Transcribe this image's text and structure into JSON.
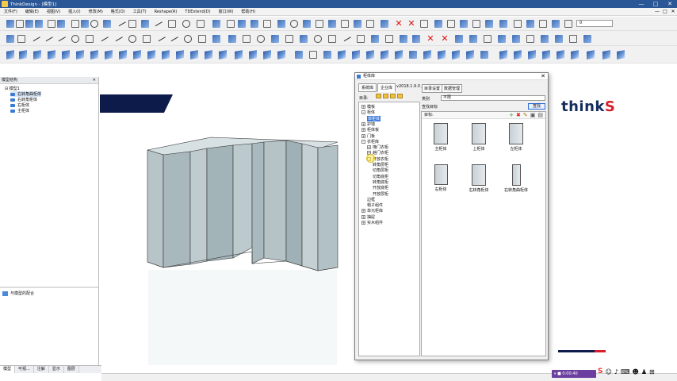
{
  "window": {
    "title": "ThinkDesign - [模型1]",
    "controls": [
      "—",
      "□",
      "✕"
    ]
  },
  "menu": {
    "items": [
      "文件(F)",
      "编辑(E)",
      "视图(V)",
      "插入(I)",
      "修改(M)",
      "格式(O)",
      "工具(T)",
      "Reshape(R)",
      "TDExtend(D)",
      "窗口(W)",
      "帮助(H)"
    ]
  },
  "toolbar": {
    "layer_value": "0"
  },
  "left_panel": {
    "title": "模型结构",
    "root": "模型1",
    "items": [
      "右转角曲柜体",
      "右转角柜体",
      "右柜体",
      "主柜体"
    ],
    "sub_item": "与模型的配合",
    "tabs": [
      "模型",
      "可视...",
      "注解",
      "显示",
      "图层"
    ]
  },
  "dialog": {
    "title": "柜体库",
    "tabs": [
      "系统库",
      "企业库"
    ],
    "version": "v2018.1.9.0 Jan 19 2019",
    "right_tabs": [
      "目录设置",
      "数据管理"
    ],
    "path_label": "目录:",
    "tree": [
      {
        "label": "模板",
        "indent": 0,
        "expander": "+"
      },
      {
        "label": "柜体",
        "indent": 0,
        "expander": "-"
      },
      {
        "label": "单柜体",
        "indent": 1,
        "expander": "",
        "selected": true
      },
      {
        "label": "护墙",
        "indent": 0,
        "expander": "+"
      },
      {
        "label": "柜体板",
        "indent": 0,
        "expander": "+"
      },
      {
        "label": "门板",
        "indent": 0,
        "expander": "+"
      },
      {
        "label": "衣柜库",
        "indent": 0,
        "expander": "-"
      },
      {
        "label": "掩门衣柜",
        "indent": 1,
        "expander": "+"
      },
      {
        "label": "趟门衣柜",
        "indent": 1,
        "expander": "+"
      },
      {
        "label": "开放衣柜",
        "indent": 1,
        "expander": "-"
      },
      {
        "label": "转角层柜",
        "indent": 2,
        "expander": ""
      },
      {
        "label": "切角层柜",
        "indent": 2,
        "expander": ""
      },
      {
        "label": "切角底柜",
        "indent": 2,
        "expander": ""
      },
      {
        "label": "转角底柜",
        "indent": 2,
        "expander": ""
      },
      {
        "label": "开放底柜",
        "indent": 2,
        "expander": ""
      },
      {
        "label": "开放层柜",
        "indent": 2,
        "expander": ""
      },
      {
        "label": "边框",
        "indent": 1,
        "expander": ""
      },
      {
        "label": "帽子组件",
        "indent": 1,
        "expander": ""
      },
      {
        "label": "单元柜库",
        "indent": 0,
        "expander": "+"
      },
      {
        "label": "抽屉",
        "indent": 0,
        "expander": "+"
      },
      {
        "label": "实木组件",
        "indent": 0,
        "expander": "+"
      }
    ],
    "category_label": "类别",
    "category_value": "不限",
    "search_label": "查找目标",
    "search_button": "查找",
    "target_label": "目标:",
    "target_tools": [
      "+",
      "✖",
      "✎",
      "▣",
      "▤"
    ],
    "items": [
      "主柜体",
      "上柜体",
      "左柜体",
      "右柜体",
      "右转角柜体",
      "右转角曲柜体"
    ]
  },
  "brand": {
    "logo_main": "think",
    "logo_accent": "S"
  },
  "status": {
    "recorder": "0:00:40"
  },
  "colors": {
    "accent": "#2b5797",
    "brand_navy": "#0d1b4a",
    "brand_red": "#d51f2b",
    "selection": "#3b78d8"
  }
}
